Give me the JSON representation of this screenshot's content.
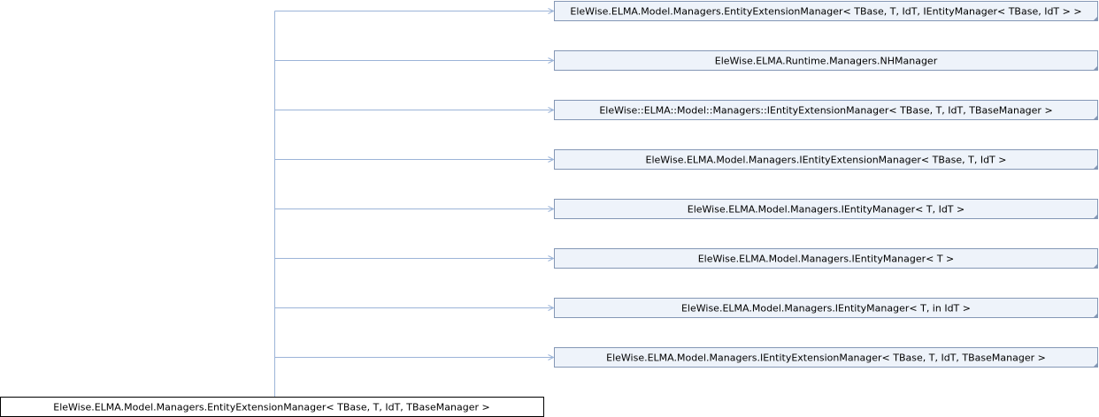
{
  "diagram": {
    "type": "class-inheritance",
    "colors": {
      "node_fill": "#eef3fa",
      "node_border": "#8497b5",
      "edge": "#9cb4d8",
      "self_border": "#000000"
    },
    "self": {
      "label": "EleWise.ELMA.Model.Managers.EntityExtensionManager< TBase, T, IdT, TBaseManager >"
    },
    "bases": [
      {
        "label": "EleWise.ELMA.Model.Managers.EntityExtensionManager< TBase, T, IdT, IEntityManager< TBase, IdT > >"
      },
      {
        "label": "EleWise.ELMA.Runtime.Managers.NHManager"
      },
      {
        "label": "EleWise::ELMA::Model::Managers::IEntityExtensionManager< TBase, T, IdT, TBaseManager >"
      },
      {
        "label": "EleWise.ELMA.Model.Managers.IEntityExtensionManager< TBase, T, IdT >"
      },
      {
        "label": "EleWise.ELMA.Model.Managers.IEntityManager< T, IdT >"
      },
      {
        "label": "EleWise.ELMA.Model.Managers.IEntityManager< T >"
      },
      {
        "label": "EleWise.ELMA.Model.Managers.IEntityManager< T, in IdT >"
      },
      {
        "label": "EleWise.ELMA.Model.Managers.IEntityExtensionManager< TBase, T, IdT, TBaseManager >"
      }
    ]
  }
}
